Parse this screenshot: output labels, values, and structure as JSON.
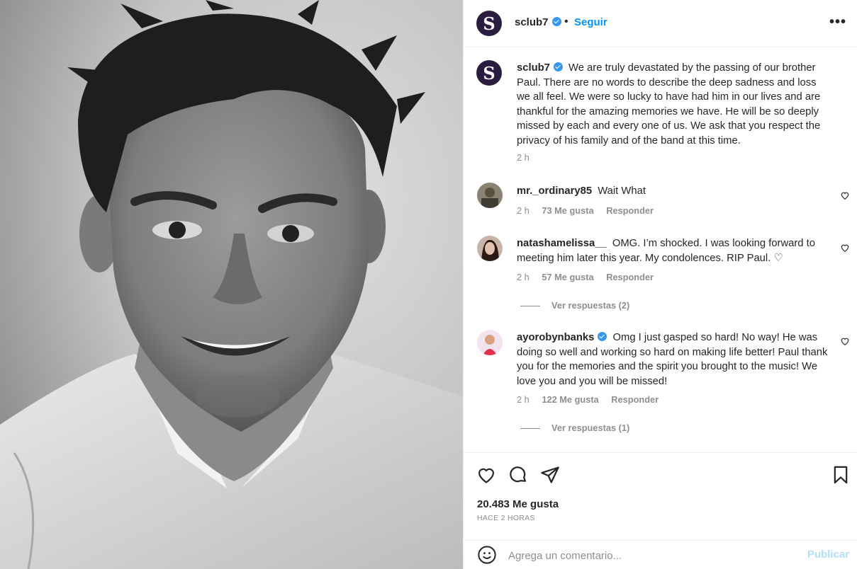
{
  "post": {
    "username": "sclub7",
    "avatar_letter": "S",
    "follow_label": "Seguir",
    "separator": "•",
    "more_label": "•••",
    "caption": "We are truly devastated by the passing of our brother Paul. There are no words to describe the deep sadness and loss we all feel. We were so lucky to have had him in our lives and are thankful for the amazing memories we have. He will be so deeply missed by each and every one of us. We ask that you respect the privacy of his family and of the band at this time.",
    "caption_time": "2 h",
    "likes_text": "20.483 Me gusta",
    "time_ago": "HACE 2 HORAS"
  },
  "comments": [
    {
      "username": "mr._ordinary85",
      "verified": false,
      "text": "Wait What",
      "time": "2 h",
      "likes": "73 Me gusta",
      "reply_label": "Responder",
      "view_replies": ""
    },
    {
      "username": "natashamelissa__",
      "verified": false,
      "text": "OMG. I’m shocked. I was looking forward to meeting him later this year. My condolences. RIP Paul. ♡",
      "time": "2 h",
      "likes": "57 Me gusta",
      "reply_label": "Responder",
      "view_replies": "Ver respuestas (2)"
    },
    {
      "username": "ayorobynbanks",
      "verified": true,
      "text": "Omg I just gasped so hard! No way! He was doing so well and working so hard on making life better! Paul thank you for the memories and the spirit you brought to the music! We love you and you will be missed!",
      "time": "2 h",
      "likes": "122 Me gusta",
      "reply_label": "Responder",
      "view_replies": "Ver respuestas (1)"
    }
  ],
  "add_comment": {
    "placeholder": "Agrega un comentario...",
    "publish_label": "Publicar"
  },
  "colors": {
    "link_blue": "#0095f6",
    "verified_blue": "#3897f0",
    "muted": "#8e8e8e",
    "publish_disabled": "#b2dffc",
    "avatar_bg": "#2b1d3f"
  }
}
